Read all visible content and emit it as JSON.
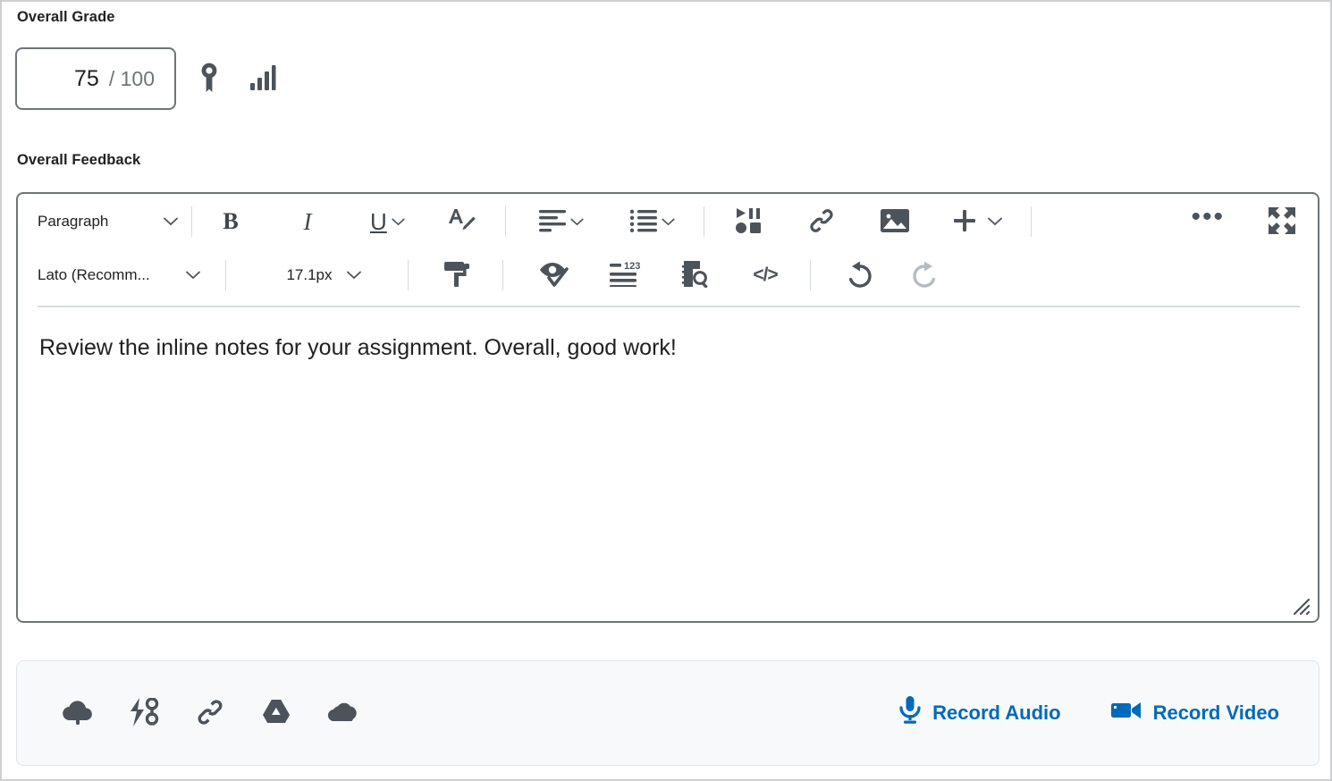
{
  "grade": {
    "label": "Overall Grade",
    "score": "75",
    "denominator": "/ 100",
    "rubric_icon": "rubric-award-icon",
    "statistics_icon": "grade-statistics-icon"
  },
  "feedback": {
    "label": "Overall Feedback",
    "body_text": "Review the inline notes for your assignment. Overall, good work!",
    "toolbar": {
      "paragraph_style": "Paragraph",
      "font_family": "Lato (Recomm...",
      "font_size": "17.1px",
      "bold_label": "B",
      "italic_label": "I",
      "underline_label": "U",
      "code_label": "</>",
      "more_label": "•••",
      "buttons": [
        "bold",
        "italic",
        "underline",
        "font-color",
        "align",
        "list",
        "insert-stuff",
        "link",
        "image",
        "add",
        "more-options",
        "fullscreen",
        "format-painter",
        "accessibility-check",
        "word-count",
        "preview",
        "html-source",
        "undo",
        "redo"
      ]
    }
  },
  "attachments": {
    "icons": [
      "upload-cloud-icon",
      "quicklink-icon",
      "link-icon",
      "google-drive-icon",
      "onedrive-icon"
    ],
    "record_audio_label": "Record Audio",
    "record_video_label": "Record Video"
  },
  "colors": {
    "accent_blue": "#0069ba",
    "icon_grey": "#4c535a",
    "border_grey": "#6e7477",
    "panel_bg": "#f7f9fb"
  }
}
